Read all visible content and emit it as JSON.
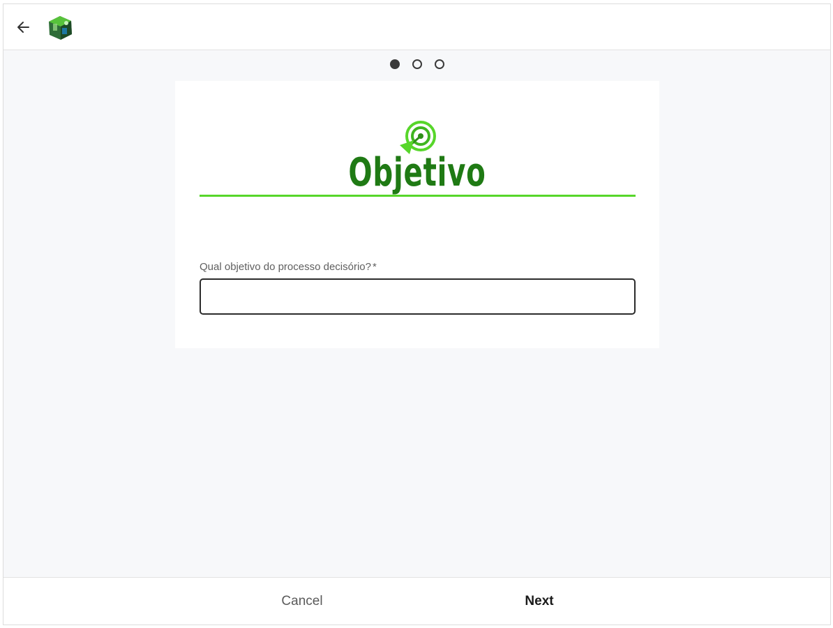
{
  "header": {
    "back_icon": "arrow-left-icon",
    "logo_icon": "app-logo-icon"
  },
  "stepper": {
    "total_steps": 3,
    "current_step": 1
  },
  "form": {
    "title": "Objetivo",
    "hero_icon": "target-arrow-icon",
    "field_label": "Qual objetivo do processo decisório?",
    "required_mark": "*",
    "field_value": "",
    "field_placeholder": ""
  },
  "footer": {
    "cancel_label": "Cancel",
    "next_label": "Next"
  },
  "colors": {
    "accent_green": "#57d62a",
    "title_green": "#1f7a14",
    "background": "#f7f8fa"
  }
}
